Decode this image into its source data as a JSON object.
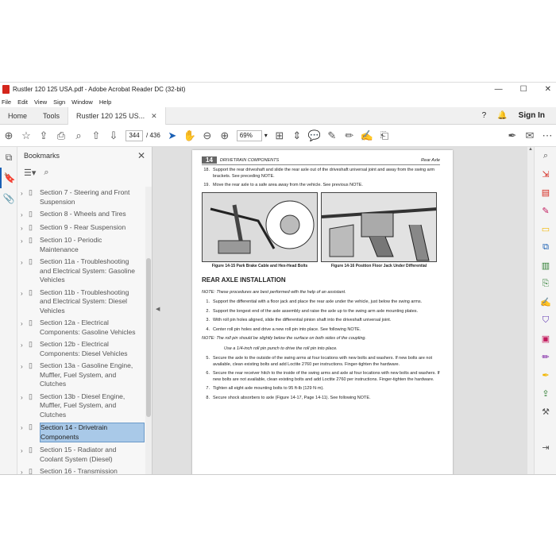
{
  "window": {
    "title": "Rustler 120 125 USA.pdf - Adobe Acrobat Reader DC (32-bit)",
    "minimize": "—",
    "maximize": "☐",
    "close": "✕"
  },
  "menu": [
    "File",
    "Edit",
    "View",
    "Sign",
    "Window",
    "Help"
  ],
  "tabs": {
    "home": "Home",
    "tools": "Tools",
    "document": "Rustler 120 125 US...",
    "signin": "Sign In"
  },
  "toolbar": {
    "current_page": "344",
    "total_pages": "/ 436",
    "zoom": "69%"
  },
  "bookmarks": {
    "title": "Bookmarks",
    "items": [
      {
        "label": "Section 7 - Steering and Front Suspension"
      },
      {
        "label": "Section 8 - Wheels and Tires"
      },
      {
        "label": "Section 9 - Rear Suspension"
      },
      {
        "label": "Section 10 - Periodic Maintenance"
      },
      {
        "label": "Section 11a - Troubleshooting and Electrical System: Gasoline Vehicles"
      },
      {
        "label": "Section 11b - Troubleshooting and Electrical System: Diesel Vehicles"
      },
      {
        "label": "Section 12a - Electrical Components: Gasoline Vehicles"
      },
      {
        "label": "Section 12b - Electrical Components: Diesel Vehicles"
      },
      {
        "label": "Section 13a - Gasoline Engine, Muffler, Fuel System, and Clutches"
      },
      {
        "label": "Section 13b - Diesel Engine, Muffler, Fuel System, and Clutches"
      },
      {
        "label": "Section 14 - Drivetrain Components",
        "selected": true
      },
      {
        "label": "Section 15 - Radiator and Coolant System (Diesel)"
      },
      {
        "label": "Section 16 - Transmission"
      }
    ]
  },
  "page": {
    "number": "14",
    "header_left": "DRIVETRAIN COMPONENTS",
    "header_right": "Rear Axle",
    "step18": {
      "n": "18.",
      "text": "Support the rear driveshaft and slide the rear axle out of the driveshaft universal joint and away from the swing arm brackets. See preceding NOTE."
    },
    "step19": {
      "n": "19.",
      "text": "Move the rear axle to a safe area away from the vehicle. See previous NOTE."
    },
    "fig1_caption": "Figure 14-15   Park Brake Cable and Hex-Head Bolts",
    "fig2_caption": "Figure 14-16   Position Floor Jack Under Differential",
    "section_title": "REAR AXLE INSTALLATION",
    "note1": "NOTE:  These procedures are best performed with the help of an assistant.",
    "steps": [
      {
        "n": "1.",
        "text": "Support the differential with a floor jack and place the rear axle under the vehicle, just below the swing arms."
      },
      {
        "n": "2.",
        "text": "Support the longest end of the axle assembly and raise the axle up to the swing arm axle mounting plates."
      },
      {
        "n": "3.",
        "text": "With roll pin holes aligned, slide the differential pinion shaft into the driveshaft universal joint."
      },
      {
        "n": "4.",
        "text": "Center roll pin holes and drive a new roll pin into place. See following NOTE."
      }
    ],
    "note2": "NOTE:  The roll pin should be slightly below the surface on both sides of the coupling.",
    "note2_sub": "Use a 1/4-inch roll pin punch to drive the roll pin into place.",
    "steps2": [
      {
        "n": "5.",
        "text": "Secure the axle to the outside of the swing arms at four locations with new bolts and washers. If new bolts are not available, clean existing bolts and add Loctite 2760 per instructions. Finger-tighten the hardware."
      },
      {
        "n": "6.",
        "text": "Secure the rear receiver hitch to the inside of the swing arms and axle at four locations with new bolts and washers. If new bolts are not available, clean existing bolts and add Loctite 2760 per instructions. Finger-tighten the hardware."
      },
      {
        "n": "7.",
        "text": "Tighten all eight axle mounting bolts to 95 ft-lb (129 N·m)."
      },
      {
        "n": "8.",
        "text": "Secure shock absorbers to axle (Figure 14-17, Page 14-11). See following NOTE."
      }
    ]
  }
}
